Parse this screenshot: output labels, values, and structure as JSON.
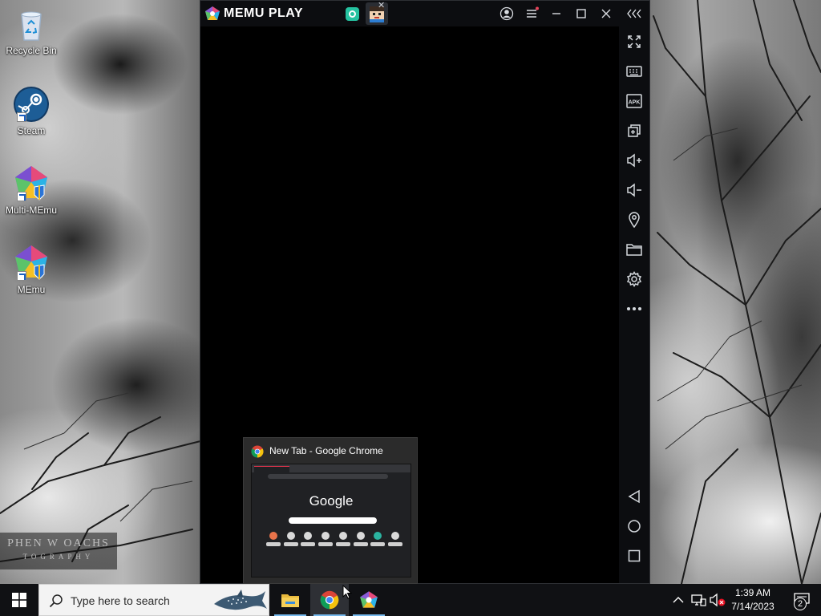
{
  "desktop": {
    "icons": [
      {
        "label": "Recycle Bin",
        "icon": "recycle-bin-icon"
      },
      {
        "label": "Steam",
        "icon": "steam-icon"
      },
      {
        "label": "Multi-MEmu",
        "icon": "multi-memu-icon"
      },
      {
        "label": "MEmu",
        "icon": "memu-icon"
      }
    ],
    "watermark": {
      "line1": "PHEN W OACHS",
      "line2": "TOGRAPHY"
    }
  },
  "memu": {
    "brand": "MEMU PLAY",
    "tabs": [
      {
        "name": "camera-app-tab",
        "icon": "camera-icon"
      },
      {
        "name": "game-app-tab",
        "icon": "game-avatar-icon",
        "active": true
      }
    ],
    "title_controls": [
      "account-icon",
      "menu-icon",
      "minimize-icon",
      "maximize-icon",
      "close-icon",
      "collapse-sidebar-icon"
    ],
    "sidebar": [
      "fullscreen-icon",
      "keyboard-mapping-icon",
      "apk-install-icon",
      "multi-window-icon",
      "volume-up-icon",
      "volume-down-icon",
      "location-icon",
      "folder-icon",
      "settings-icon",
      "more-icon",
      "back-icon",
      "home-icon",
      "recents-icon"
    ],
    "colors": {
      "background": "#000000",
      "chrome": "#0c0d10",
      "icon": "#d5d9de"
    }
  },
  "chrome_preview": {
    "title": "New Tab - Google Chrome",
    "thumbnail_logo": "Google"
  },
  "taskbar": {
    "search_placeholder": "Type here to search",
    "apps": [
      {
        "name": "file-explorer",
        "icon": "folder-icon",
        "active": true
      },
      {
        "name": "google-chrome",
        "icon": "chrome-icon",
        "active": true
      },
      {
        "name": "memu",
        "icon": "memu-icon",
        "active": true
      }
    ],
    "clock": {
      "time": "1:39 AM",
      "date": "7/14/2023"
    },
    "notifications": "2"
  }
}
